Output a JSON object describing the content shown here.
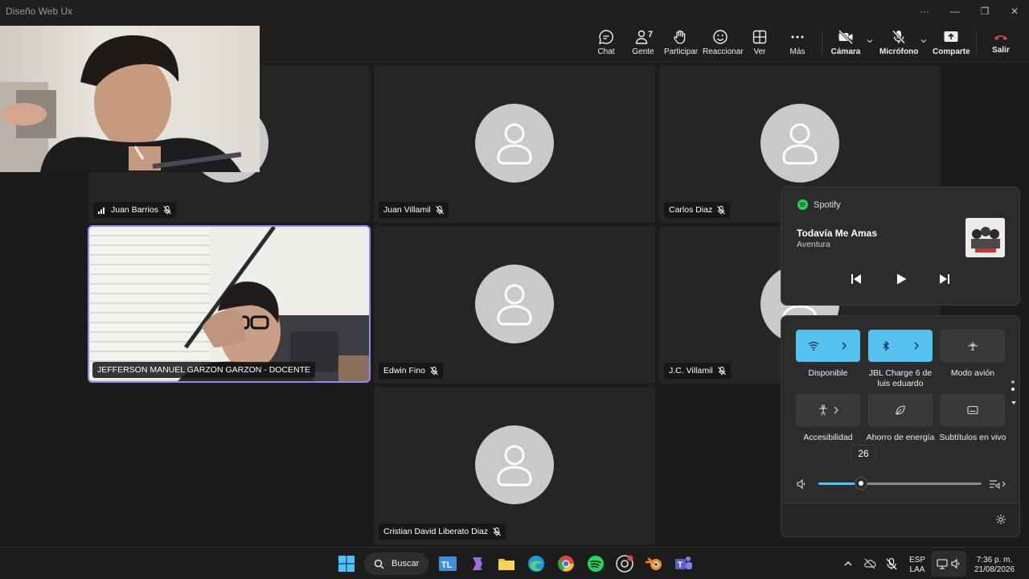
{
  "window": {
    "title": "Diseño Web Ux"
  },
  "toolbar": {
    "chat": "Chat",
    "people": "Gente",
    "people_count": "7",
    "raise": "Participar",
    "react": "Reaccionar",
    "view": "Ver",
    "more": "Más",
    "camera": "Cámara",
    "mic": "Micrófono",
    "share": "Comparte",
    "leave": "Salir"
  },
  "participants": [
    {
      "name": "Juan Barrios",
      "muted": true,
      "signal": true
    },
    {
      "name": "Juan Villamil",
      "muted": true
    },
    {
      "name": "Carlos Diaz",
      "muted": true
    },
    {
      "name": "JEFFERSON MANUEL GARZON GARZON - DOCENTE",
      "muted": false,
      "video": true,
      "speaking": true
    },
    {
      "name": "Edwin Fino",
      "muted": true
    },
    {
      "name": "J.C. Villamil",
      "muted": true
    },
    {
      "name": "Cristian David Liberato Diaz",
      "muted": true
    }
  ],
  "media": {
    "app": "Spotify",
    "song": "Todavía Me Amas",
    "artist": "Aventura"
  },
  "quick_settings": {
    "wifi_label": "Disponible",
    "bluetooth_label": "JBL Charge 6 de luis eduardo",
    "airplane_label": "Modo avión",
    "accessibility_label": "Accesibilidad",
    "battery_saver_label": "Ahorro de energía",
    "captions_label": "Subtítulos en vivo",
    "volume": 26,
    "volume_label": "26"
  },
  "taskbar": {
    "search": "Buscar",
    "lang_top": "ESP",
    "lang_bottom": "LAA",
    "time": "7:36 p. m.",
    "date": "21/08/2026"
  },
  "colors": {
    "accent": "#56c2ef",
    "speaker_outline": "#8b8cf0",
    "spotify_green": "#1ed760",
    "leave_red": "#e5484d"
  }
}
